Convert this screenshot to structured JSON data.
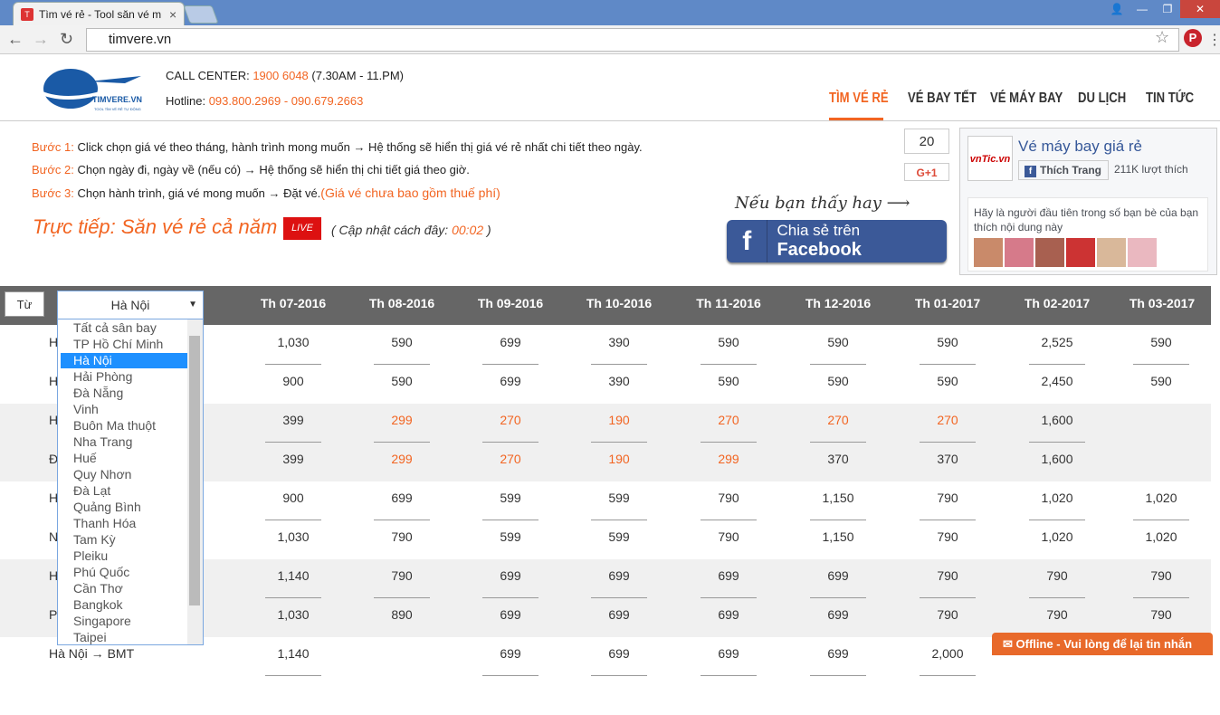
{
  "browser": {
    "tab_title": "Tìm vé rẻ - Tool săn vé m",
    "url": "timvere.vn"
  },
  "header": {
    "cc_label": "CALL CENTER: ",
    "cc_number": "1900 6048",
    "cc_hours": " (7.30AM - 11.PM)",
    "hotline_label": "Hotline: ",
    "hotline_numbers": "093.800.2969 - 090.679.2663",
    "logo_text": "TIMVERE.VN",
    "logo_sub": "TOOL TÌM VÉ RẺ TỰ ĐỘNG"
  },
  "nav": [
    "TÌM VÉ RẺ",
    "VÉ BAY TẾT",
    "VÉ MÁY BAY",
    "DU LỊCH",
    "TIN TỨC"
  ],
  "steps": [
    {
      "label": "Bước 1:",
      "text": " Click chọn giá vé theo tháng, hành trình mong muốn → Hệ thống sẽ hiển thị giá vé rẻ nhất chi tiết theo ngày.",
      "note": ""
    },
    {
      "label": "Bước 2:",
      "text": " Chọn ngày đi, ngày về (nếu có) → Hệ thống sẽ hiển thị chi tiết giá theo giờ.",
      "note": ""
    },
    {
      "label": "Bước 3:",
      "text": " Chọn hành trình, giá vé mong muốn → Đặt vé.",
      "note": "(Giá vé chưa bao gồm thuế phí)"
    }
  ],
  "live": {
    "title": "Trực tiếp: Săn vé rẻ cả năm",
    "badge": "LIVE",
    "update": "( Cập nhật cách đây: ",
    "time": "00:02",
    " close": " )"
  },
  "social": {
    "gplus_count": "20",
    "gplus_label": "G+1",
    "handwrite": "Nếu bạn thấy hay",
    "share": "Chia sẻ trên ",
    "share_b": "Facebook"
  },
  "fb": {
    "page": "Vé máy bay giá rẻ",
    "logo": "vnTic.vn",
    "like": "Thích Trang",
    "count": "211K lượt thích",
    "prompt": "Hãy là người đầu tiên trong số bạn bè của bạn thích nội dung này"
  },
  "table": {
    "from_label": "Từ",
    "selected": "Hà Nội",
    "months": [
      "Th 07-2016",
      "Th 08-2016",
      "Th 09-2016",
      "Th 10-2016",
      "Th 11-2016",
      "Th 12-2016",
      "Th 01-2017",
      "Th 02-2017",
      "Th 03-2017"
    ],
    "rows": [
      [
        "1,030",
        "590",
        "699",
        "390",
        "590",
        "590",
        "590",
        "2,525",
        "590"
      ],
      [
        "900",
        "590",
        "699",
        "390",
        "590",
        "590",
        "590",
        "2,450",
        "590"
      ],
      [
        "399",
        "299",
        "270",
        "190",
        "270",
        "270",
        "270",
        "1,600",
        ""
      ],
      [
        "399",
        "299",
        "270",
        "190",
        "299",
        "370",
        "370",
        "1,600",
        ""
      ],
      [
        "900",
        "699",
        "599",
        "599",
        "790",
        "1,150",
        "790",
        "1,020",
        "1,020"
      ],
      [
        "1,030",
        "790",
        "599",
        "599",
        "790",
        "1,150",
        "790",
        "1,020",
        "1,020"
      ],
      [
        "1,140",
        "790",
        "699",
        "699",
        "699",
        "699",
        "790",
        "790",
        "790"
      ],
      [
        "1,030",
        "890",
        "699",
        "699",
        "699",
        "699",
        "790",
        "790",
        "790"
      ],
      [
        "1,140",
        "",
        "699",
        "699",
        "699",
        "699",
        "2,000",
        "",
        ""
      ]
    ],
    "orange": [
      [
        2,
        1
      ],
      [
        2,
        2
      ],
      [
        2,
        3
      ],
      [
        2,
        4
      ],
      [
        2,
        5
      ],
      [
        2,
        6
      ],
      [
        3,
        1
      ],
      [
        3,
        2
      ],
      [
        3,
        3
      ],
      [
        3,
        4
      ]
    ],
    "row_labels": [
      "H",
      "H",
      "H",
      "Đ",
      "H",
      "N",
      "H",
      "P",
      "Hà Nội → BMT"
    ]
  },
  "dropdown": [
    "Tất cả sân bay",
    "TP Hồ Chí Minh",
    "Hà Nội",
    "Hải Phòng",
    "Đà Nẵng",
    "Vinh",
    "Buôn Ma thuột",
    "Nha Trang",
    "Huế",
    "Quy Nhơn",
    "Đà Lạt",
    "Quảng Bình",
    "Thanh Hóa",
    "Tam Kỳ",
    "Pleiku",
    "Phú Quốc",
    "Cần Thơ",
    "Bangkok",
    "Singapore",
    "Taipei"
  ],
  "offline": "Offline - Vui lòng để lại tin nhắn"
}
